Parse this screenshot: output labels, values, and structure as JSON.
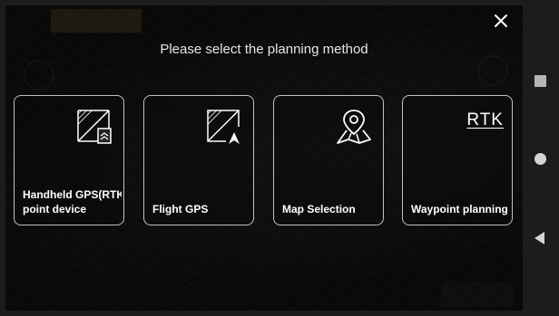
{
  "dialog": {
    "title": "Please select the planning method",
    "close_icon": "close-icon"
  },
  "options": [
    {
      "label_line1": "Handheld GPS(RTK",
      "label_line2": "point device",
      "icon": "handheld-gps-icon"
    },
    {
      "label": "Flight GPS",
      "icon": "flight-gps-icon"
    },
    {
      "label": "Map Selection",
      "icon": "map-pin-icon"
    },
    {
      "label": "Waypoint planning",
      "icon_text": "RTK",
      "icon": "rtk-icon"
    }
  ],
  "navbar": {
    "recents_icon": "square-icon",
    "home_icon": "circle-icon",
    "back_icon": "back-triangle-icon"
  },
  "colors": {
    "overlay": "#000000",
    "card_border": "#ffffff",
    "text": "#ffffff",
    "navbar_bg": "#1c1c1c"
  }
}
